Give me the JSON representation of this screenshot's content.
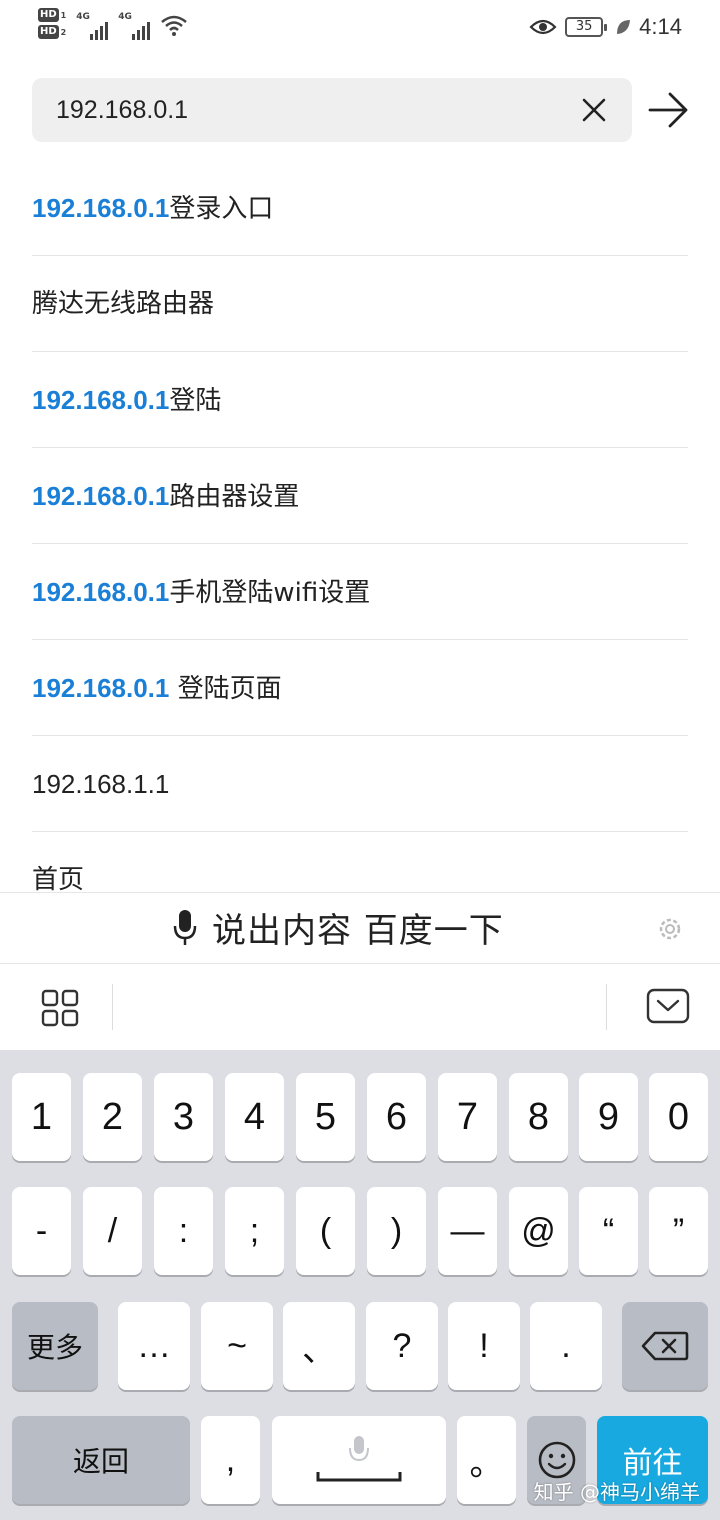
{
  "status_bar": {
    "hd1": "HD",
    "hd1_num": "1",
    "hd2": "HD",
    "hd2_num": "2",
    "net1": "4G",
    "net2": "4G",
    "battery": "35",
    "time": "4:14"
  },
  "search": {
    "value": "192.168.0.1"
  },
  "suggestions": [
    {
      "highlight": "192.168.0.1",
      "rest": "登录入口"
    },
    {
      "highlight": "",
      "rest": "腾达无线路由器"
    },
    {
      "highlight": "192.168.0.1",
      "rest": "登陆"
    },
    {
      "highlight": "192.168.0.1",
      "rest": "路由器设置"
    },
    {
      "highlight": "192.168.0.1",
      "rest": "手机登陆wifi设置"
    },
    {
      "highlight": "192.168.0.1",
      "rest": " 登陆页面"
    },
    {
      "highlight": "",
      "rest": "192.168.1.1"
    },
    {
      "highlight": "",
      "rest": "首页"
    }
  ],
  "voice_bar": {
    "label": "说出内容 百度一下"
  },
  "keyboard": {
    "row1": [
      "1",
      "2",
      "3",
      "4",
      "5",
      "6",
      "7",
      "8",
      "9",
      "0"
    ],
    "row2": [
      "-",
      "/",
      ":",
      ";",
      "(",
      ")",
      "—",
      "@",
      "“",
      "”"
    ],
    "row3_more": "更多",
    "row3": [
      "…",
      "~",
      "、",
      "?",
      "!",
      "."
    ],
    "row4_back": "返回",
    "row4_comma": ",",
    "row4_period": "。",
    "row4_go": "前往"
  },
  "watermark": "知乎 @神马小绵羊",
  "colors": {
    "highlight": "#1a7fd6",
    "go_key": "#17a9e0",
    "keyboard_bg": "#dcdee3"
  }
}
